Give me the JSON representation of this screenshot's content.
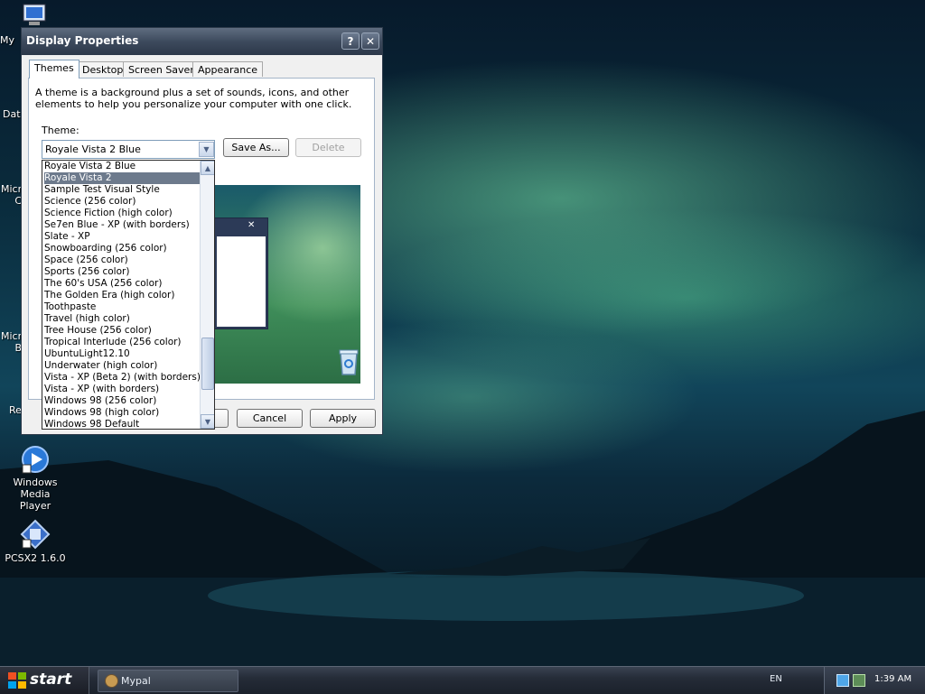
{
  "desktop": {
    "icons": [
      {
        "name": "my-computer",
        "label": "My"
      },
      {
        "name": "data",
        "label": "Dat"
      },
      {
        "name": "micro-1",
        "label": "Micro",
        "sub": "C"
      },
      {
        "name": "micro-2",
        "label": "Micro",
        "sub": "B"
      },
      {
        "name": "recycle",
        "label": "Re"
      },
      {
        "name": "windows-media-player",
        "label": "Windows Media",
        "sub": "Player"
      },
      {
        "name": "pcsx2",
        "label": "PCSX2 1.6.0"
      }
    ]
  },
  "window": {
    "title": "Display Properties",
    "help_glyph": "?",
    "close_glyph": "✕",
    "tabs": [
      {
        "label": "Themes",
        "active": true
      },
      {
        "label": "Desktop"
      },
      {
        "label": "Screen Saver"
      },
      {
        "label": "Appearance"
      }
    ],
    "description": "A theme is a background plus a set of sounds, icons, and other elements to help you personalize your computer with one click.",
    "theme_label": "Theme:",
    "theme_value": "Royale Vista 2 Blue",
    "save_as_label": "Save As...",
    "delete_label": "Delete",
    "cancel_label": "Cancel",
    "apply_label": "Apply",
    "dropdown_items": [
      "Royale Vista 2 Blue",
      "Royale Vista 2",
      "Sample Test Visual Style",
      "Science (256 color)",
      "Science Fiction (high color)",
      "Se7en Blue - XP (with borders)",
      "Slate - XP",
      "Snowboarding (256 color)",
      "Space (256 color)",
      "Sports (256 color)",
      "The 60's USA (256 color)",
      "The Golden Era (high color)",
      "Toothpaste",
      "Travel (high color)",
      "Tree House (256 color)",
      "Tropical Interlude (256 color)",
      "UbuntuLight12.10",
      "Underwater (high color)",
      "Vista - XP (Beta 2) (with borders)",
      "Vista - XP (with borders)",
      "Windows 98 (256 color)",
      "Windows 98 (high color)",
      "Windows 98 Default"
    ],
    "dropdown_selected_index": 1
  },
  "taskbar": {
    "start_label": "start",
    "task_label": "Mypal",
    "language": "EN",
    "clock": "1:39 AM"
  }
}
